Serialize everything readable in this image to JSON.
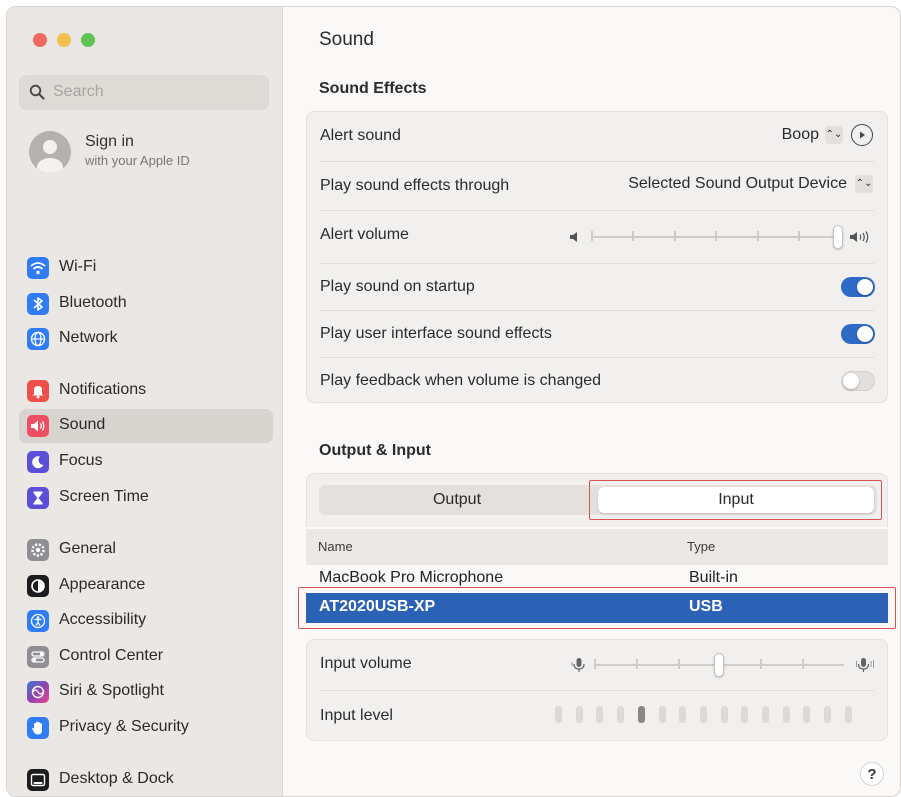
{
  "sidebar": {
    "search_placeholder": "Search",
    "signin": {
      "title": "Sign in",
      "subtitle": "with your Apple ID"
    },
    "items": [
      {
        "label": "Wi-Fi",
        "icon": "wifi-icon",
        "color": "#2f7cf6"
      },
      {
        "label": "Bluetooth",
        "icon": "bluetooth-icon",
        "color": "#2f7cf6"
      },
      {
        "label": "Network",
        "icon": "globe-icon",
        "color": "#2f7cf6"
      },
      {
        "label": "Notifications",
        "icon": "bell-icon",
        "color": "#ee4f4a"
      },
      {
        "label": "Sound",
        "icon": "speaker-icon",
        "color": "#ee4f63",
        "selected": true
      },
      {
        "label": "Focus",
        "icon": "moon-icon",
        "color": "#5a4fd6"
      },
      {
        "label": "Screen Time",
        "icon": "hourglass-icon",
        "color": "#5a4fd6"
      },
      {
        "label": "General",
        "icon": "gear-icon",
        "color": "#8e8e93"
      },
      {
        "label": "Appearance",
        "icon": "appearance-icon",
        "color": "#1c1c1e"
      },
      {
        "label": "Accessibility",
        "icon": "accessibility-icon",
        "color": "#2f7cf6"
      },
      {
        "label": "Control Center",
        "icon": "toggles-icon",
        "color": "#8e8e93"
      },
      {
        "label": "Siri & Spotlight",
        "icon": "siri-icon",
        "color": "#7a3fd1"
      },
      {
        "label": "Privacy & Security",
        "icon": "hand-icon",
        "color": "#2f7cf6"
      },
      {
        "label": "Desktop & Dock",
        "icon": "dock-icon",
        "color": "#1c1c1e"
      }
    ]
  },
  "main": {
    "title": "Sound",
    "sound_effects": {
      "heading": "Sound Effects",
      "alert_sound": {
        "label": "Alert sound",
        "value": "Boop"
      },
      "play_through": {
        "label": "Play sound effects through",
        "value": "Selected Sound Output Device"
      },
      "alert_volume": {
        "label": "Alert volume",
        "level": 1.0
      },
      "startup": {
        "label": "Play sound on startup",
        "on": true
      },
      "ui_effects": {
        "label": "Play user interface sound effects",
        "on": true
      },
      "feedback": {
        "label": "Play feedback when volume is changed",
        "on": false
      }
    },
    "output_input": {
      "heading": "Output & Input",
      "tabs": [
        "Output",
        "Input"
      ],
      "active_tab": "Input",
      "columns": [
        "Name",
        "Type"
      ],
      "devices": [
        {
          "name": "MacBook Pro Microphone",
          "type": "Built-in"
        },
        {
          "name": "AT2020USB-XP",
          "type": "USB",
          "selected": true
        }
      ],
      "input_volume": {
        "label": "Input volume",
        "level": 0.5
      },
      "input_level": {
        "label": "Input level",
        "segments": 15,
        "lit": 5
      }
    },
    "help_label": "?"
  },
  "colors": {
    "accent": "#2e6bc6",
    "highlight_box": "#d9534f"
  }
}
